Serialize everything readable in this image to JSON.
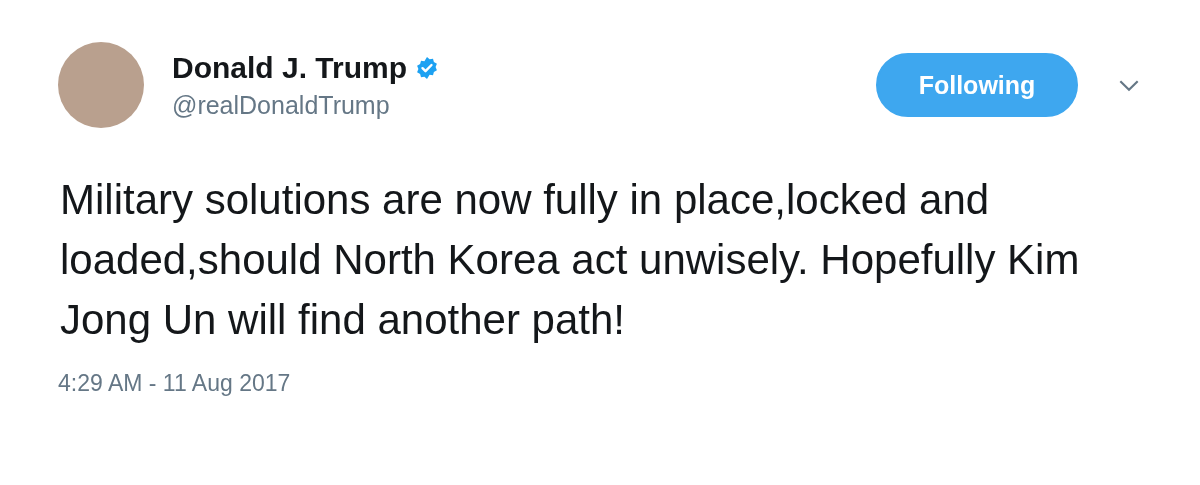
{
  "author": {
    "name": "Donald J. Trump",
    "verified": true,
    "handle": "@realDonaldTrump"
  },
  "follow_button": {
    "label": "Following",
    "following": true
  },
  "tweet": {
    "text": "Military solutions are now fully in place,locked and loaded,should North Korea act unwisely.  Hopefully Kim Jong Un will find another path!",
    "timestamp": "4:29 AM - 11 Aug 2017"
  }
}
